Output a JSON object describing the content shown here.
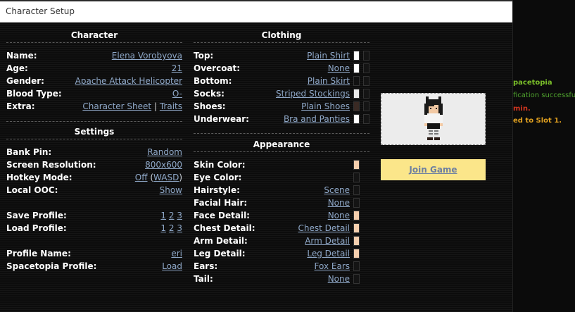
{
  "window": {
    "title": "Character Setup"
  },
  "colors": {
    "link": "#8fa8c8",
    "join_bg": "#fbe68a"
  },
  "chat": [
    {
      "text": "pacetopia",
      "color": "#7bbf2a"
    },
    {
      "text": "fication successful.",
      "color": "#4fa32e"
    },
    {
      "text": "min.",
      "color": "#d0351f"
    },
    {
      "text": "ed to Slot 1.",
      "color": "#e0a020"
    }
  ],
  "character": {
    "title": "Character",
    "name_label": "Name:",
    "name_value": "Elena Vorobyova",
    "age_label": "Age:",
    "age_value": "21",
    "gender_label": "Gender:",
    "gender_value": "Apache Attack Helicopter",
    "blood_label": "Blood Type:",
    "blood_value": "O-",
    "extra_label": "Extra:",
    "extra_sheet": "Character Sheet",
    "extra_sep": "|",
    "extra_traits": "Traits"
  },
  "settings": {
    "title": "Settings",
    "bankpin_label": "Bank Pin:",
    "bankpin_value": "Random",
    "resolution_label": "Screen Resolution:",
    "resolution_value": "800x600",
    "hotkey_label": "Hotkey Mode:",
    "hotkey_value": "Off",
    "hotkey_alt": "WASD",
    "hotkey_open": "(",
    "hotkey_close": ")",
    "ooc_label": "Local OOC:",
    "ooc_value": "Show",
    "save_label": "Save Profile:",
    "load_label": "Load Profile:",
    "slots": [
      "1",
      "2",
      "3"
    ],
    "profile_name_label": "Profile Name:",
    "profile_name_value": "eri",
    "spacetopia_label": "Spacetopia Profile:",
    "spacetopia_value": "Load"
  },
  "clothing": {
    "title": "Clothing",
    "items": [
      {
        "label": "Top:",
        "value": "Plain Shirt",
        "color": "#ffffff"
      },
      {
        "label": "Overcoat:",
        "value": "None",
        "color": "#ffffff"
      },
      {
        "label": "Bottom:",
        "value": "Plain Skirt",
        "color": "#111111"
      },
      {
        "label": "Socks:",
        "value": "Striped Stockings",
        "color": "#e8e8e8"
      },
      {
        "label": "Shoes:",
        "value": "Plain Shoes",
        "color": "#3a2a24"
      },
      {
        "label": "Underwear:",
        "value": "Bra and Panties",
        "color": "#ffffff"
      }
    ]
  },
  "appearance": {
    "title": "Appearance",
    "items": [
      {
        "label": "Skin Color:",
        "value": "",
        "color": "#f5cfae"
      },
      {
        "label": "Eye Color:",
        "value": "",
        "color": "#141414"
      },
      {
        "label": "Hairstyle:",
        "value": "Scene",
        "color": "#141414"
      },
      {
        "label": "Facial Hair:",
        "value": "None",
        "color": "#141414"
      },
      {
        "label": "Face Detail:",
        "value": "None",
        "color": "#f5cfae"
      },
      {
        "label": "Chest Detail:",
        "value": "Chest Detail",
        "color": "#f5cfae"
      },
      {
        "label": "Arm Detail:",
        "value": "Arm Detail",
        "color": "#f5cfae"
      },
      {
        "label": "Leg Detail:",
        "value": "Leg Detail",
        "color": "#f5cfae"
      },
      {
        "label": "Ears:",
        "value": "Fox Ears",
        "color": "#141414"
      },
      {
        "label": "Tail:",
        "value": "None",
        "color": "#141414"
      }
    ]
  },
  "actions": {
    "join_label": "Join Game"
  }
}
